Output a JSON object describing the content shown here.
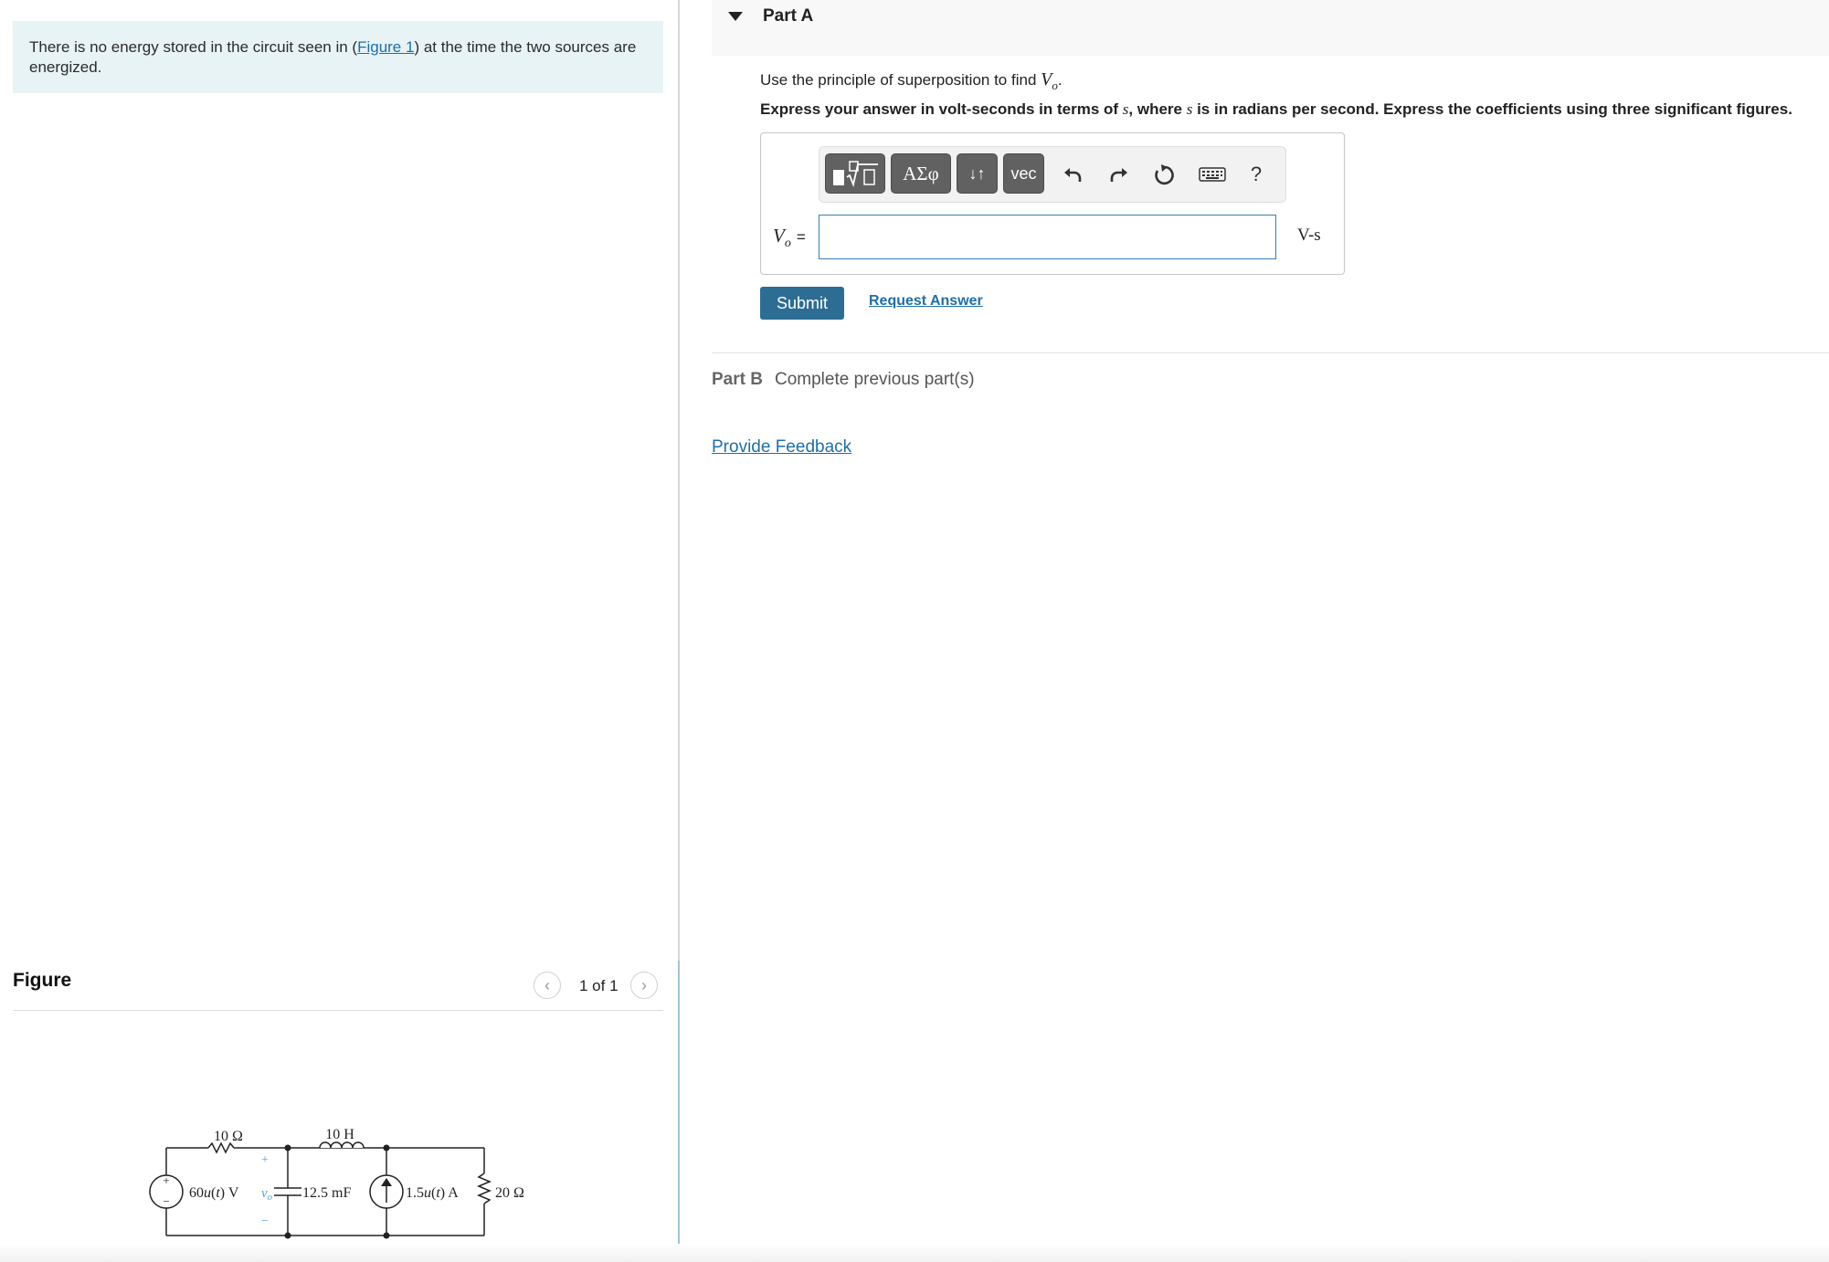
{
  "intro": {
    "text_before": "There is no energy stored in the circuit seen in (",
    "figure_link": "Figure 1",
    "text_after": ") at the time the two sources are energized."
  },
  "figure": {
    "title": "Figure",
    "counter": "1 of 1",
    "prev_icon": "chevron-left-icon",
    "next_icon": "chevron-right-icon",
    "circuit": {
      "r1": "10 Ω",
      "inductor": "10 H",
      "source_v_pre": "60",
      "source_v_fn": "u",
      "source_v_arg": "(",
      "source_v_t": "t",
      "source_v_post": ") V",
      "vo_label": "v",
      "vo_sub": "o",
      "plus": "+",
      "minus": "−",
      "src_plus": "+",
      "src_minus": "−",
      "capacitor": "12.5 mF",
      "source_i_pre": "1.5",
      "source_i_fn": "u",
      "source_i_arg": "(",
      "source_i_t": "t",
      "source_i_post": ") A",
      "r2": "20 Ω"
    }
  },
  "partA": {
    "title": "Part A",
    "question_prefix": "Use the principle of superposition to find ",
    "question_var": "V",
    "question_sub": "o",
    "question_suffix": ".",
    "instr_1": "Express your answer in volt-seconds in terms of ",
    "instr_s1": "s",
    "instr_2": ", where ",
    "instr_s2": "s",
    "instr_3": " is in radians per second. Express the coefficients using three significant figures.",
    "toolbar": {
      "templates_icon": "fraction-radical-icon",
      "greek_label": "ΑΣφ",
      "arrows_label": "↓↑",
      "vec_label": "vec",
      "undo_icon": "undo-icon",
      "redo_icon": "redo-icon",
      "reset_icon": "reset-icon",
      "keyboard_icon": "keyboard-icon",
      "help_label": "?"
    },
    "answer_var": "V",
    "answer_sub": "o",
    "answer_eq": "=",
    "answer_value": "",
    "unit": "V-s",
    "submit_label": "Submit",
    "request_label": "Request Answer"
  },
  "partB": {
    "label": "Part B",
    "status": "Complete previous part(s)"
  },
  "feedback_label": "Provide Feedback"
}
